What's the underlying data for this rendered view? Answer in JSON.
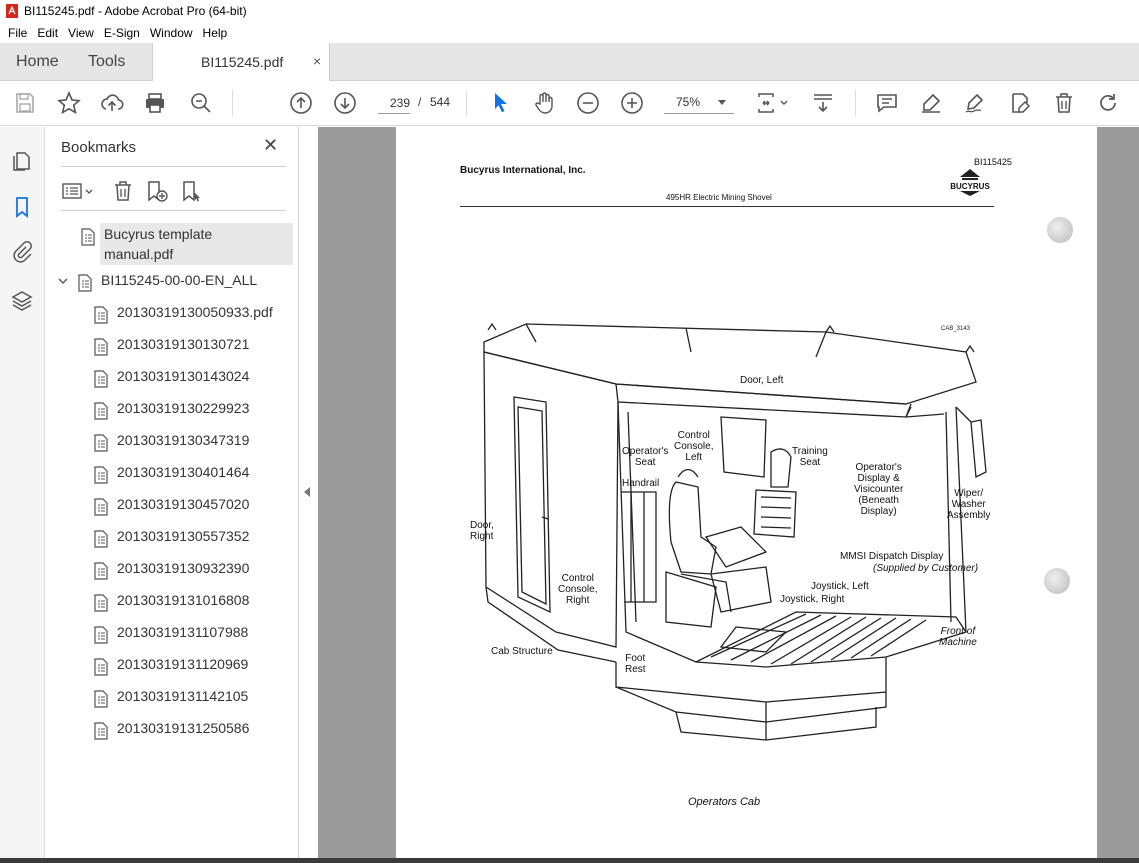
{
  "window": {
    "title": "BI115245.pdf - Adobe Acrobat Pro (64-bit)"
  },
  "menu": [
    "File",
    "Edit",
    "View",
    "E-Sign",
    "Window",
    "Help"
  ],
  "tabs": {
    "home": "Home",
    "tools": "Tools",
    "document": "BI115245.pdf",
    "close": "×"
  },
  "toolbar": {
    "current_page": "239",
    "page_sep": "/",
    "total_pages": "544",
    "zoom": "75%",
    "icons": [
      "save-icon",
      "bookmark-star-icon",
      "upload-icon",
      "print-icon",
      "zoom-search-icon",
      "prev-page-icon",
      "next-page-icon",
      "select-cursor-icon",
      "hand-icon",
      "zoom-out-icon",
      "zoom-in-icon",
      "fit-page-icon",
      "scroll-mode-icon",
      "comment-icon",
      "highlight-icon",
      "sign-icon",
      "edit-pdf-icon",
      "delete-icon",
      "redo-icon"
    ]
  },
  "bookmarks": {
    "title": "Bookmarks",
    "close": "✕",
    "items": [
      {
        "label": "Bucyrus template manual.pdf",
        "line1": "Bucyrus template",
        "line2": "manual.pdf",
        "selected": true
      },
      {
        "label": "BI115245-00-00-EN_ALL",
        "expanded": true
      },
      {
        "label": "20130319130050933.pdf"
      },
      {
        "label": "20130319130130721"
      },
      {
        "label": "20130319130143024"
      },
      {
        "label": "20130319130229923"
      },
      {
        "label": "20130319130347319"
      },
      {
        "label": "20130319130401464"
      },
      {
        "label": "20130319130457020"
      },
      {
        "label": "20130319130557352"
      },
      {
        "label": "20130319130932390"
      },
      {
        "label": "20130319131016808"
      },
      {
        "label": "20130319131107988"
      },
      {
        "label": "20130319131120969"
      },
      {
        "label": "20130319131142105"
      },
      {
        "label": "20130319131250586"
      }
    ]
  },
  "page": {
    "company": "Bucyrus International, Inc.",
    "doc_number": "BI115425",
    "logo_text": "BUCYRUS",
    "subtitle": "495HR Electric Mining Shovel",
    "figure_id": "CAB_3143",
    "caption": "Operators Cab",
    "labels": {
      "door_left": "Door, Left",
      "control_console_left": "Control\nConsole,\nLeft",
      "operators_seat": "Operator's\nSeat",
      "training_seat": "Training\nSeat",
      "handrail": "Handrail",
      "operators_display": "Operator's\nDisplay &\nVisicounter\n(Beneath\nDisplay)",
      "wiper": "Wiper/\nWasher\nAssembly",
      "door_right": "Door,\nRight",
      "mmsi": "MMSI Dispatch Display",
      "mmsi_sub": "(Supplied by Customer)",
      "control_console_right": "Control\nConsole,\nRight",
      "joystick_left": "Joystick, Left",
      "joystick_right": "Joystick, Right",
      "front_of_machine": "Front of\nMachine",
      "cab_structure": "Cab Structure",
      "foot_rest": "Foot\nRest"
    }
  }
}
